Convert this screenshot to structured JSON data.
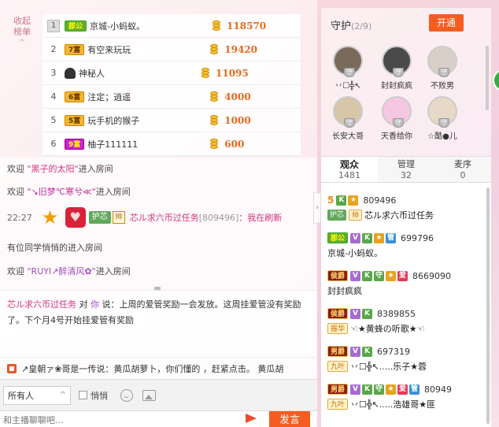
{
  "rank": {
    "collapse_label_1": "收起",
    "collapse_label_2": "榜单",
    "collapse_arrow": "^",
    "rows": [
      {
        "num": "1",
        "badge": "郡公",
        "badge_type": "gov",
        "name": "京城-小蚂蚁。",
        "score": "118570"
      },
      {
        "num": "2",
        "badge": "7富",
        "badge_type": "rich",
        "name": "有空来玩玩",
        "score": "19420"
      },
      {
        "num": "3",
        "badge": "",
        "badge_type": "mystery",
        "name": "神秘人",
        "score": "11095"
      },
      {
        "num": "4",
        "badge": "6富",
        "badge_type": "rich",
        "name": "注定；逍遥",
        "score": "4000"
      },
      {
        "num": "5",
        "badge": "5富",
        "badge_type": "rich",
        "name": "玩手机的猴子",
        "score": "1000"
      },
      {
        "num": "6",
        "badge": "9富",
        "badge_type": "rich9",
        "name": "柚子111111",
        "score": "600"
      }
    ]
  },
  "chat": {
    "line1_pre": "欢迎 ",
    "line1_user": "\"黑子的太阳\"",
    "line1_post": "进入房间",
    "line2_pre": "欢迎 ",
    "line2_user": "\"↘旧梦℃寒兮≪\"",
    "line2_post": "进入房间",
    "time": "22:27",
    "guard_label": "护芯",
    "shi_label": "帅",
    "speaker": "芯ル求六币过任务",
    "speaker_id": "[809496]",
    "speaker_msg": "：我在刷新",
    "line4": "有位同学悄悄的进入房间",
    "line5_pre": "欢迎 ",
    "line5_user": "\"RUYI↗醉清风✿\"",
    "line5_post": "进入房间"
  },
  "message": {
    "user": "芯ル求六币过任务",
    "to": " 对 ",
    "target": "你",
    "says": " 说：",
    "text": "上周的爱管奖励一会发放。这周挂爱管没有奖励了。下个月4号开始挂爱管有奖励"
  },
  "marquee": {
    "text": "↗皇朝ァ❀哥是一传说：黄瓜胡萝卜，你们懂的 ，赶紧点击。 黄瓜胡"
  },
  "target_bar": {
    "selected": "所有人",
    "whisper_label": "悄悄"
  },
  "input": {
    "placeholder": "和主播聊聊吧...",
    "send_label": "发言"
  },
  "guard": {
    "title": "守护",
    "count": "(2/9)",
    "open_label": "开通",
    "members": [
      {
        "name": "丷☐╬↖",
        "color": "#7a6a5a"
      },
      {
        "name": "封封疯疯",
        "color": "#4a4a4a"
      },
      {
        "name": "不败男",
        "color": "#d8d0c8"
      },
      {
        "name": "长安大哥",
        "color": "#d7c7a8"
      },
      {
        "name": "天香给你",
        "color": "#f6c7e2"
      },
      {
        "name": "☆酷●儿",
        "color": "#e8d8c8"
      }
    ]
  },
  "tabs": [
    {
      "label": "观众",
      "count": "1481"
    },
    {
      "label": "管理",
      "count": "32"
    },
    {
      "label": "麦序",
      "count": "0"
    }
  ],
  "users": [
    {
      "level": "5",
      "tags": [
        "K",
        "★"
      ],
      "id": "809496",
      "name_tags": [
        "护芯",
        "帅"
      ],
      "name": "芯ル求六币过任务"
    },
    {
      "level": "",
      "role": "郡公",
      "tags": [
        "V",
        "K",
        "★",
        "管"
      ],
      "id": "699796",
      "name_tags": [],
      "name": "京城-小蚂蚁。"
    },
    {
      "level": "",
      "role": "侯爵",
      "tags": [
        "V",
        "K",
        "守",
        "★",
        "爱"
      ],
      "id": "8669090",
      "name_tags": [],
      "name": "封封疯疯"
    },
    {
      "level": "",
      "role": "侯爵",
      "tags": [
        "V",
        "K"
      ],
      "id": "8389855",
      "name_tags": [
        "振华"
      ],
      "name": "☜★黄蜂の听歌★☜"
    },
    {
      "level": "",
      "role": "男爵",
      "tags": [
        "V",
        "K"
      ],
      "id": "697319",
      "name_tags": [
        "九叶"
      ],
      "name": "丷☐╬↖.....乐子★蓉"
    },
    {
      "level": "",
      "role": "男爵",
      "tags": [
        "V",
        "K",
        "守",
        "★",
        "爱",
        "管"
      ],
      "id": "80949",
      "name_tags": [
        "九叶"
      ],
      "name": "丷☐╬↖.....浩雄哥★匪"
    }
  ]
}
